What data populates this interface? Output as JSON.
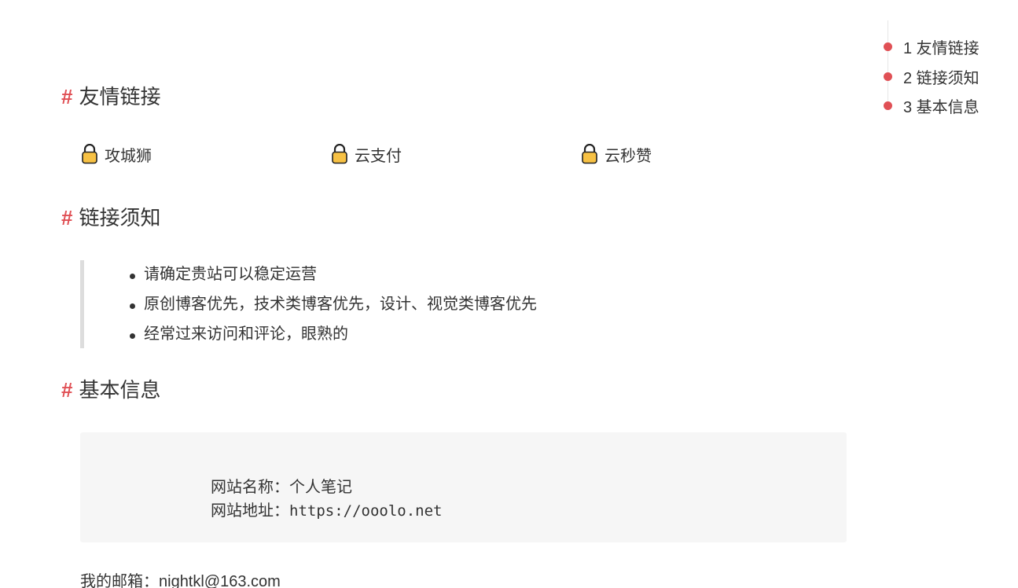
{
  "toc": {
    "items": [
      {
        "label": "1 友情链接"
      },
      {
        "label": "2 链接须知"
      },
      {
        "label": "3 基本信息"
      }
    ]
  },
  "sections": {
    "friends": {
      "hash": "#",
      "title": "友情链接"
    },
    "notice": {
      "hash": "#",
      "title": "链接须知"
    },
    "info": {
      "hash": "#",
      "title": "基本信息"
    }
  },
  "links": [
    {
      "label": "攻城狮",
      "icon": "lock-icon"
    },
    {
      "label": "云支付",
      "icon": "lock-icon"
    },
    {
      "label": "云秒赞",
      "icon": "lock-icon"
    }
  ],
  "notice_items": [
    "请确定贵站可以稳定运营",
    "原创博客优先，技术类博客优先，设计、视觉类博客优先",
    "经常过来访问和评论，眼熟的"
  ],
  "info": {
    "name_label": "网站名称：",
    "name_value": "个人笔记",
    "url_label": "网站地址：",
    "url_value": "https://ooolo.net"
  },
  "email": "我的邮箱：nightkl@163.com",
  "colors": {
    "accent": "#e05055",
    "text": "#333333",
    "code_bg": "#f6f6f6",
    "lock_body": "#f7c144"
  }
}
